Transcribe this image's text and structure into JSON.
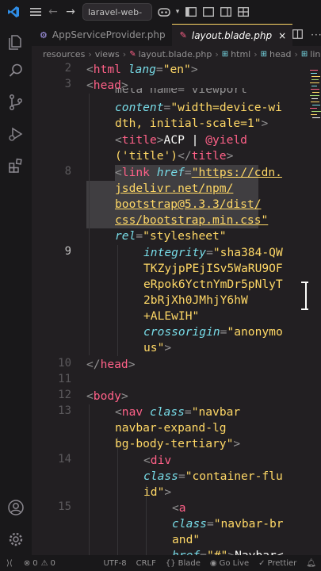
{
  "titlebar": {
    "command_center": "laravel-web-",
    "back_glyph": "←",
    "forward_glyph": "→"
  },
  "tabs": [
    {
      "label": "AppServiceProvider.php",
      "icon": "php-file-icon"
    },
    {
      "label": "layout.blade.php",
      "icon": "blade-file-icon",
      "close": "×"
    }
  ],
  "breadcrumb": [
    "resources",
    "views",
    "layout.blade.php",
    "html",
    "head",
    "link"
  ],
  "breadcrumb_sep": "›",
  "line_numbers": [
    "2",
    "3",
    "",
    "8",
    "9",
    "10",
    "11",
    "12",
    "13",
    "14",
    "15"
  ],
  "code": {
    "l2": {
      "tag": "html",
      "attr": "lang",
      "val": "\"en\""
    },
    "l3": {
      "tag": "head"
    },
    "l_meta_top": {
      "text": "meta name=\"viewport\""
    },
    "l_content": {
      "attr": "content",
      "val1": "\"width=device-wi",
      "val2": "dth, initial-scale=1\""
    },
    "l_title": {
      "tag": "title",
      "text": "ACP | ",
      "directive": "@yield",
      "arg": "('title')",
      "close_tag": "title"
    },
    "l8": {
      "tag": "link",
      "attr": "href",
      "url1": "\"https://cdn.",
      "url2": "jsdelivr.net/npm/",
      "url3": "bootstrap@5.3.3/dist/",
      "url4": "css/bootstrap.min.css\"",
      "rel_attr": "rel",
      "rel_val": "\"stylesheet\""
    },
    "l9": {
      "attr1": "integrity",
      "val1": "\"sha384-QW",
      "val2": "TKZyjpPEjISv5WaRU9OF",
      "val3": "eRpok6YctnYmDr5pNlyT",
      "val4": "2bRjXh0JMhjY6hW",
      "val5": "+ALEwIH\"",
      "attr2": "crossorigin",
      "val6": "\"anonymo",
      "val7": "us\""
    },
    "l10": {
      "tag": "head"
    },
    "l12": {
      "tag": "body"
    },
    "l13": {
      "tag": "nav",
      "attr": "class",
      "val1": "\"navbar",
      "val2": "navbar-expand-lg",
      "val3": "bg-body-tertiary\""
    },
    "l14": {
      "tag": "div",
      "attr": "class",
      "val1": "\"container-flu",
      "val2": "id\""
    },
    "l15": {
      "tag": "a",
      "attr": "class",
      "val1": "\"navbar-br",
      "val2": "and\"",
      "attr2": "href",
      "val3": "\"#\"",
      "text": "Navbar<"
    }
  },
  "statusbar": {
    "errors": "0",
    "warnings": "0",
    "encoding": "UTF-8",
    "eol": "CRLF",
    "language_braces": "{}",
    "language": "Blade",
    "golive": "Go Live",
    "prettier": "Prettier"
  },
  "colors": {
    "background": "#221f22",
    "tag": "#ff6188",
    "attribute": "#78dce8",
    "string": "#ffd866",
    "function": "#a9dc76",
    "active_tab_accent": "#ffd866"
  },
  "icons": [
    "vscode-logo-icon",
    "menu-icon",
    "copilot-icon",
    "layout-icon",
    "explorer-icon",
    "search-icon",
    "source-control-icon",
    "run-debug-icon",
    "extensions-icon",
    "account-icon",
    "settings-gear-icon"
  ]
}
